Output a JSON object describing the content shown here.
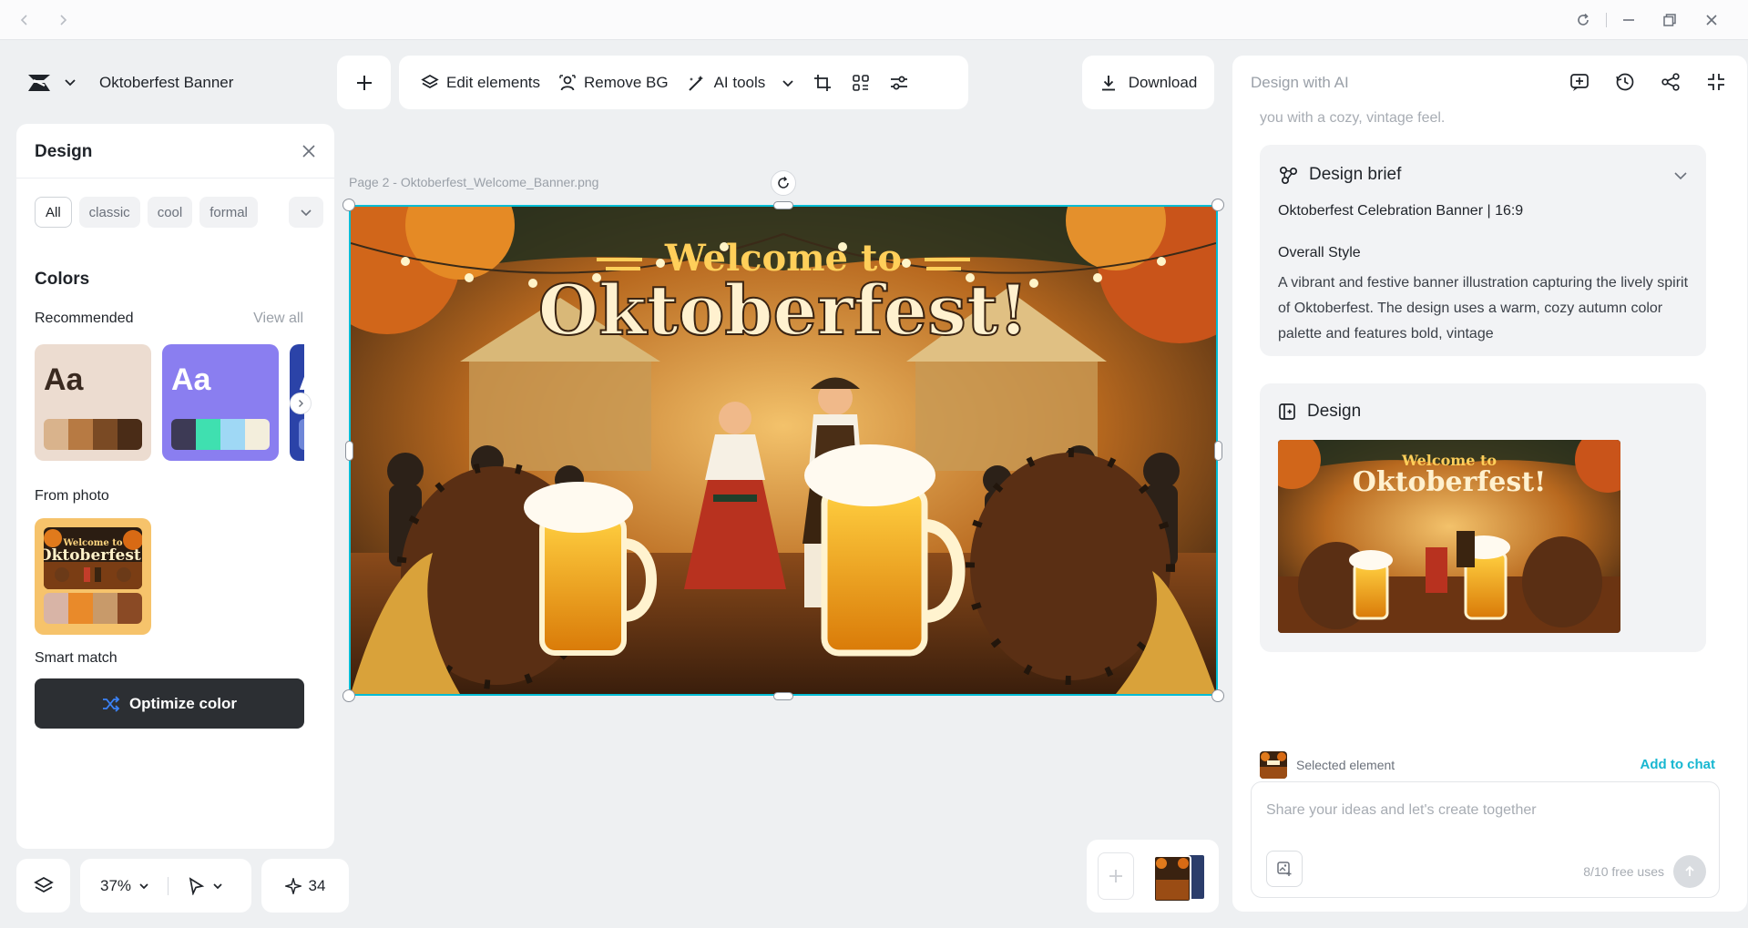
{
  "titlebar": {
    "back_icon": "chevron-left-icon",
    "forward_icon": "chevron-right-icon",
    "reload_icon": "reload-icon",
    "minimize_icon": "minimize-icon",
    "restore_icon": "restore-icon",
    "close_icon": "close-icon"
  },
  "doc": {
    "name": "Oktoberfest Banner",
    "logo_icon": "brand-logo-icon"
  },
  "toolbar": {
    "add_icon": "plus-icon",
    "edit_elements": "Edit elements",
    "remove_bg": "Remove BG",
    "ai_tools": "AI tools",
    "crop_icon": "crop-icon",
    "scan_icon": "scan-icon",
    "adjust_icon": "sliders-icon"
  },
  "download": {
    "label": "Download"
  },
  "left_panel": {
    "title": "Design",
    "chips": [
      "All",
      "classic",
      "cool",
      "formal"
    ],
    "colors_title": "Colors",
    "recommended": "Recommended",
    "view_all": "View all",
    "swatch_text": "Aa",
    "palettes": [
      {
        "bg": "#ecdcd0",
        "text": "#3a2a20",
        "colors": [
          "#d9b38c",
          "#b77a43",
          "#7a4a24",
          "#4a2c17"
        ]
      },
      {
        "bg": "#8a7ef0",
        "text": "#ffffff",
        "colors": [
          "#3d3a55",
          "#3fe0b0",
          "#9fd8f5",
          "#f3eedc"
        ]
      },
      {
        "bg": "#2b43a8",
        "text": "#ffffff",
        "colors": [
          "#6e86d8",
          "#2b43a8"
        ]
      }
    ],
    "from_photo": "From photo",
    "photo_palette": [
      "#d8b4a6",
      "#e98a2a",
      "#c89a6a",
      "#8a4a25"
    ],
    "smart_match": "Smart match",
    "optimize_label": "Optimize color"
  },
  "canvas": {
    "label": "Page 2 -  Oktoberfest_Welcome_Banner.png",
    "banner_line1": "Welcome to",
    "banner_line2": "Oktoberfest!"
  },
  "bottom": {
    "zoom": "37%",
    "credits": "34",
    "layers_icon": "layers-icon",
    "pointer_icon": "pointer-icon",
    "sparkle_icon": "sparkle-icon"
  },
  "right_panel": {
    "title": "Design with AI",
    "faded_text": "you with a cozy, vintage feel.",
    "brief_title": "Design brief",
    "brief_line": "Oktoberfest Celebration Banner | 16:9",
    "overall_style": "Overall Style",
    "brief_paragraph": "A vibrant and festive banner illustration capturing the lively spirit of Oktoberfest. The design uses a warm, cozy autumn color palette and features bold, vintage",
    "design_title": "Design",
    "selected_element": "Selected element",
    "add_to_chat": "Add to chat",
    "chat_placeholder": "Share your ideas and let's create together",
    "free_uses": "8/10 free uses"
  },
  "colors": {
    "accent": "#17b7d1",
    "selection": "#00bcd4",
    "dark_button": "#2c2f33"
  }
}
